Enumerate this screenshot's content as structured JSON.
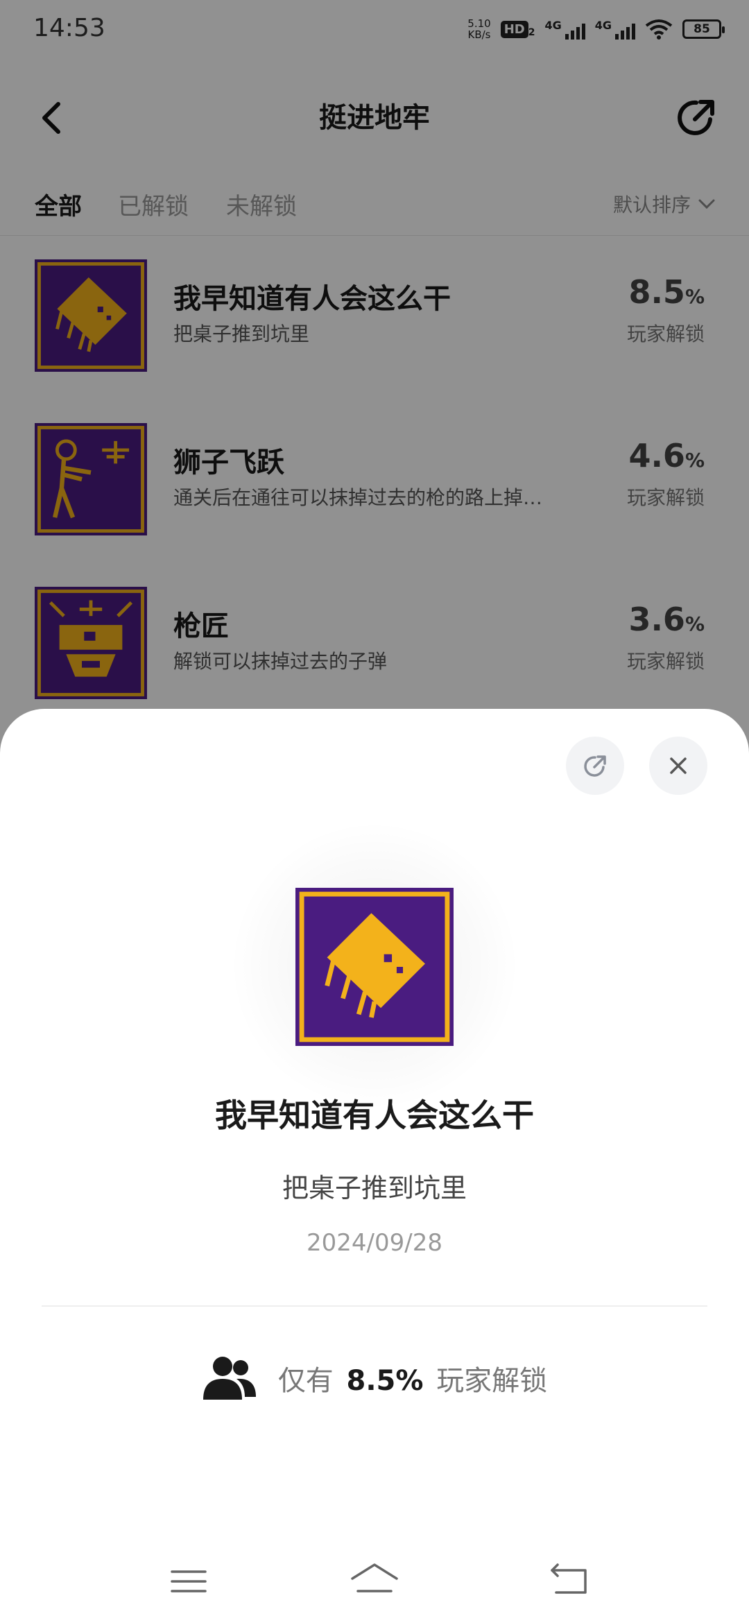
{
  "status_bar": {
    "time": "14:53",
    "net_speed_value": "5.10",
    "net_speed_unit": "KB/s",
    "hd_label": "HD",
    "hd_sub": "2",
    "signal1_label": "4G",
    "signal2_label": "4G",
    "battery": "85"
  },
  "header": {
    "title": "挺进地牢",
    "back_icon": "chevron-left-icon",
    "share_icon": "share-icon"
  },
  "tabs": [
    {
      "label": "全部",
      "active": true
    },
    {
      "label": "已解锁",
      "active": false
    },
    {
      "label": "未解锁",
      "active": false
    }
  ],
  "sort": {
    "label": "默认排序",
    "icon": "chevron-down-icon"
  },
  "achievements": [
    {
      "name": "我早知道有人会这么干",
      "desc": "把桌子推到坑里",
      "percent": "8.5",
      "percent_unit": "%",
      "label": "玩家解锁"
    },
    {
      "name": "狮子飞跃",
      "desc": "通关后在通往可以抹掉过去的枪的路上掉…",
      "percent": "4.6",
      "percent_unit": "%",
      "label": "玩家解锁"
    },
    {
      "name": "枪匠",
      "desc": "解锁可以抹掉过去的子弹",
      "percent": "3.6",
      "percent_unit": "%",
      "label": "玩家解锁"
    }
  ],
  "sheet": {
    "title": "我早知道有人会这么干",
    "desc": "把桌子推到坑里",
    "date": "2024/09/28",
    "stat_prefix": "仅有",
    "stat_value": "8.5%",
    "stat_suffix": "玩家解锁",
    "share_icon": "share-icon",
    "close_icon": "close-icon",
    "users_icon": "users-icon"
  },
  "colors": {
    "icon_purple": "#4a1c80",
    "icon_gold": "#f3b21b",
    "overlay": "rgba(0,0,0,0.43)"
  }
}
